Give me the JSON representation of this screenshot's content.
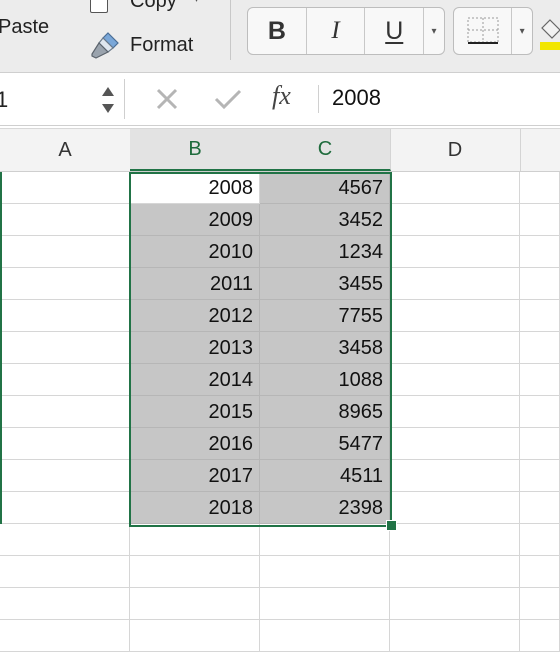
{
  "ribbon": {
    "paste_label": "Paste",
    "copy_label": "Copy",
    "format_label": "Format",
    "bold_label": "B",
    "italic_label": "I",
    "underline_label": "U"
  },
  "formula_bar": {
    "name_box_value": "1",
    "fx_label": "fx",
    "value": "2008"
  },
  "columns": [
    "A",
    "B",
    "C",
    "D"
  ],
  "rows": [
    {
      "b": "2008",
      "c": "4567"
    },
    {
      "b": "2009",
      "c": "3452"
    },
    {
      "b": "2010",
      "c": "1234"
    },
    {
      "b": "2011",
      "c": "3455"
    },
    {
      "b": "2012",
      "c": "7755"
    },
    {
      "b": "2013",
      "c": "3458"
    },
    {
      "b": "2014",
      "c": "1088"
    },
    {
      "b": "2015",
      "c": "8965"
    },
    {
      "b": "2016",
      "c": "5477"
    },
    {
      "b": "2017",
      "c": "4511"
    },
    {
      "b": "2018",
      "c": "2398"
    }
  ],
  "colors": {
    "selection": "#217346",
    "selected_fill": "#c6c6c6"
  }
}
